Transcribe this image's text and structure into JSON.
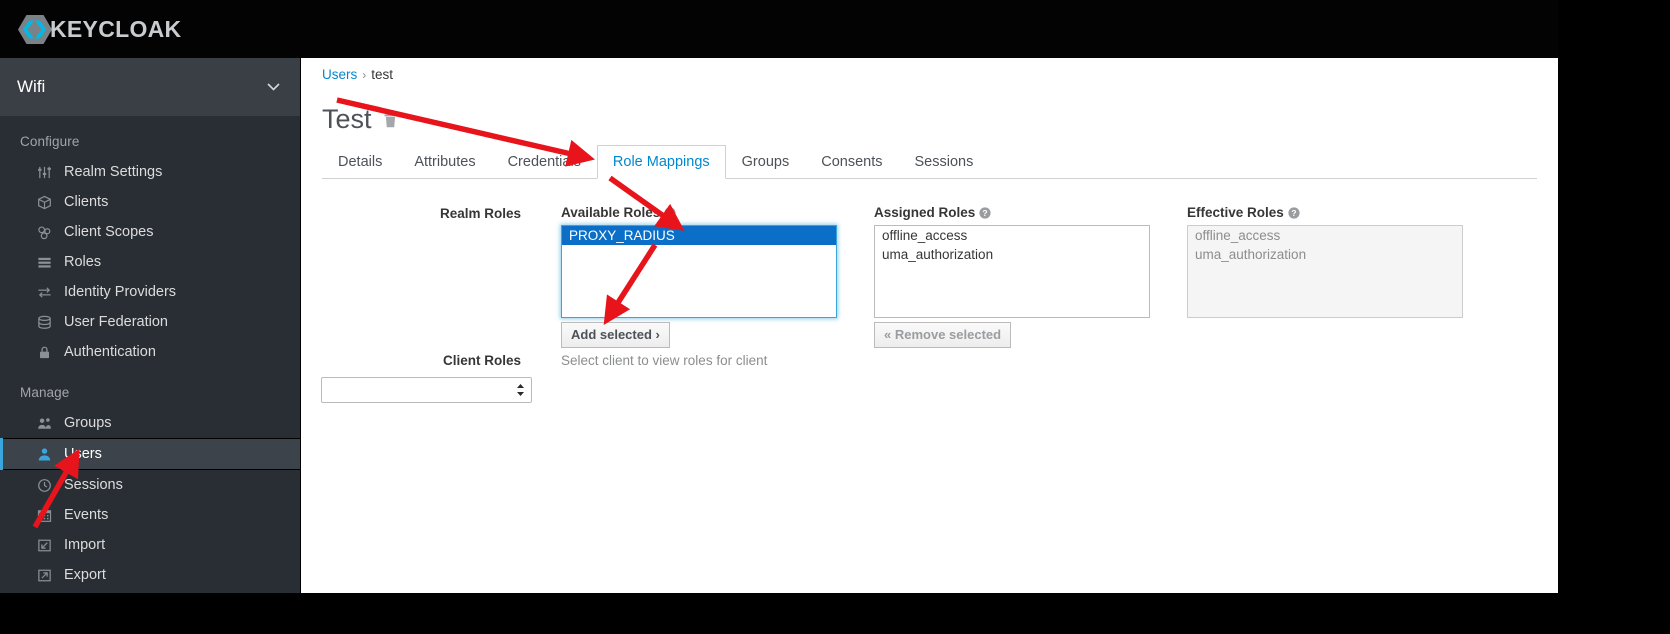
{
  "masthead": {
    "logo_text": "KEYCLOAK",
    "logo_icon": "keycloak-hexagon-logo"
  },
  "sidebar": {
    "realm": {
      "name": "Wifi",
      "chevron_icon": "chevron-down-icon"
    },
    "sections": [
      {
        "title": "Configure",
        "items": [
          {
            "label": "Realm Settings",
            "icon": "sliders-icon",
            "active": false
          },
          {
            "label": "Clients",
            "icon": "cube-icon",
            "active": false
          },
          {
            "label": "Client Scopes",
            "icon": "blocks-icon",
            "active": false
          },
          {
            "label": "Roles",
            "icon": "list-rows-icon",
            "active": false
          },
          {
            "label": "Identity Providers",
            "icon": "exchange-arrows-icon",
            "active": false
          },
          {
            "label": "User Federation",
            "icon": "database-icon",
            "active": false
          },
          {
            "label": "Authentication",
            "icon": "lock-icon",
            "active": false
          }
        ]
      },
      {
        "title": "Manage",
        "items": [
          {
            "label": "Groups",
            "icon": "users-group-icon",
            "active": false
          },
          {
            "label": "Users",
            "icon": "user-icon",
            "active": true
          },
          {
            "label": "Sessions",
            "icon": "clock-icon",
            "active": false
          },
          {
            "label": "Events",
            "icon": "calendar-icon",
            "active": false
          },
          {
            "label": "Import",
            "icon": "import-arrow-icon",
            "active": false
          },
          {
            "label": "Export",
            "icon": "export-arrow-icon",
            "active": false
          }
        ]
      }
    ]
  },
  "breadcrumb": {
    "root": "Users",
    "separator": "›",
    "current": "test"
  },
  "page": {
    "title": "Test",
    "delete_icon": "trash-icon"
  },
  "tabs": [
    {
      "label": "Details",
      "active": false
    },
    {
      "label": "Attributes",
      "active": false
    },
    {
      "label": "Credentials",
      "active": false
    },
    {
      "label": "Role Mappings",
      "active": true
    },
    {
      "label": "Groups",
      "active": false
    },
    {
      "label": "Consents",
      "active": false
    },
    {
      "label": "Sessions",
      "active": false
    }
  ],
  "role_mappings": {
    "realm_roles_label": "Realm Roles",
    "available": {
      "label": "Available Roles",
      "help_icon": "question-circle-icon",
      "options": [
        {
          "value": "PROXY_RADIUS",
          "selected": true
        }
      ],
      "add_button": "Add selected ›"
    },
    "assigned": {
      "label": "Assigned Roles",
      "help_icon": "question-circle-icon",
      "options": [
        {
          "value": "offline_access",
          "selected": false
        },
        {
          "value": "uma_authorization",
          "selected": false
        }
      ],
      "remove_button": "« Remove selected"
    },
    "effective": {
      "label": "Effective Roles",
      "help_icon": "question-circle-icon",
      "options": [
        {
          "value": "offline_access",
          "selected": false
        },
        {
          "value": "uma_authorization",
          "selected": false
        }
      ]
    },
    "client_roles_label": "Client Roles",
    "client_roles_hint": "Select client to view roles for client",
    "client_select_value": "",
    "client_select_icon": "stepper-updown-icon"
  },
  "colors": {
    "accent_blue": "#0088ce",
    "active_nav_blue": "#39a5dc",
    "selection_blue": "#0b6fc8",
    "sidebar_bg": "#292e34",
    "annotation_red": "#e8141b"
  }
}
